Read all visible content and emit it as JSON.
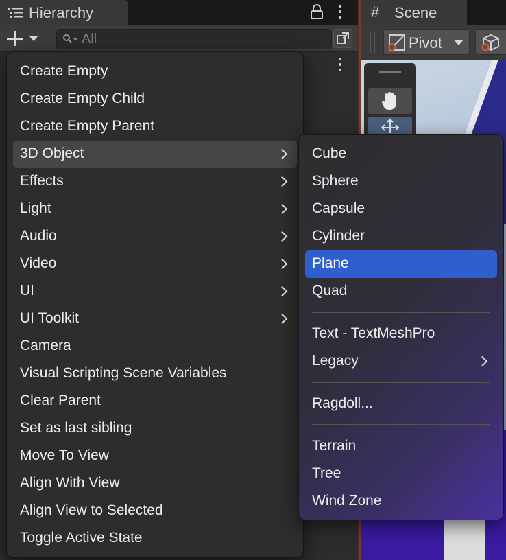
{
  "hierarchy": {
    "tab_title": "Hierarchy",
    "search_placeholder": "All"
  },
  "scene": {
    "tab_title": "Scene",
    "pivot_label": "Pivot"
  },
  "context_menu": {
    "items": [
      {
        "label": "Create Empty",
        "has_submenu": false
      },
      {
        "label": "Create Empty Child",
        "has_submenu": false
      },
      {
        "label": "Create Empty Parent",
        "has_submenu": false
      },
      {
        "label": "3D Object",
        "has_submenu": true,
        "state": "hover"
      },
      {
        "label": "Effects",
        "has_submenu": true
      },
      {
        "label": "Light",
        "has_submenu": true
      },
      {
        "label": "Audio",
        "has_submenu": true
      },
      {
        "label": "Video",
        "has_submenu": true
      },
      {
        "label": "UI",
        "has_submenu": true
      },
      {
        "label": "UI Toolkit",
        "has_submenu": true
      },
      {
        "label": "Camera",
        "has_submenu": false
      },
      {
        "label": "Visual Scripting Scene Variables",
        "has_submenu": false
      },
      {
        "label": "Clear Parent",
        "has_submenu": false
      },
      {
        "label": "Set as last sibling",
        "has_submenu": false
      },
      {
        "label": "Move To View",
        "has_submenu": false
      },
      {
        "label": "Align With View",
        "has_submenu": false
      },
      {
        "label": "Align View to Selected",
        "has_submenu": false
      },
      {
        "label": "Toggle Active State",
        "has_submenu": false
      }
    ]
  },
  "submenu_3d_object": {
    "items": [
      {
        "label": "Cube"
      },
      {
        "label": "Sphere"
      },
      {
        "label": "Capsule"
      },
      {
        "label": "Cylinder"
      },
      {
        "label": "Plane",
        "state": "selected"
      },
      {
        "label": "Quad"
      },
      {
        "label": "Text - TextMeshPro"
      },
      {
        "label": "Legacy",
        "has_submenu": true
      },
      {
        "label": "Ragdoll..."
      },
      {
        "label": "Terrain"
      },
      {
        "label": "Tree"
      },
      {
        "label": "Wind Zone"
      }
    ]
  },
  "colors": {
    "selection_blue": "#2f5fcd",
    "hover_gray": "#464646",
    "menu_bg": "#2d2d2d",
    "focus_orange": "#7a3a25"
  }
}
